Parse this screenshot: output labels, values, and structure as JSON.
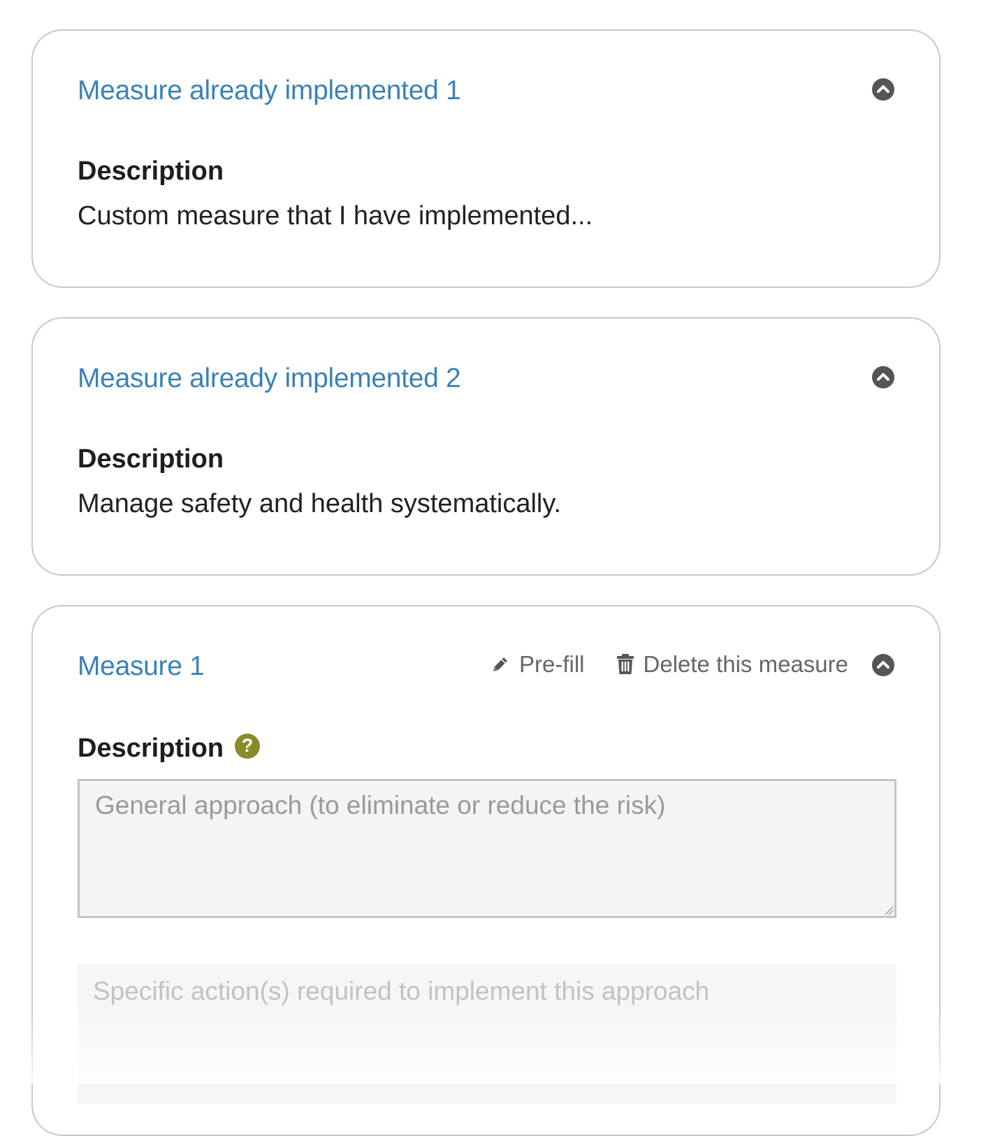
{
  "implemented_measures": [
    {
      "title": "Measure already implemented 1",
      "description_label": "Description",
      "description": "Custom measure that I have implemented..."
    },
    {
      "title": "Measure already implemented 2",
      "description_label": "Description",
      "description": "Manage safety and health systematically."
    }
  ],
  "measure": {
    "title": "Measure 1",
    "prefill_label": "Pre-fill",
    "delete_label": "Delete this measure",
    "description_label": "Description",
    "help_glyph": "?",
    "general_approach_placeholder": "General approach (to eliminate or reduce the risk)",
    "specific_actions_placeholder": "Specific action(s) required to implement this approach"
  },
  "icons": {
    "collapse": "chevron-up-circle-icon",
    "prefill": "pencil-icon",
    "delete": "trash-icon",
    "help": "question-circle-icon"
  },
  "colors": {
    "title_blue": "#3a82b8",
    "help_olive": "#8a8a2a",
    "border_gray": "#c8c8c8"
  }
}
